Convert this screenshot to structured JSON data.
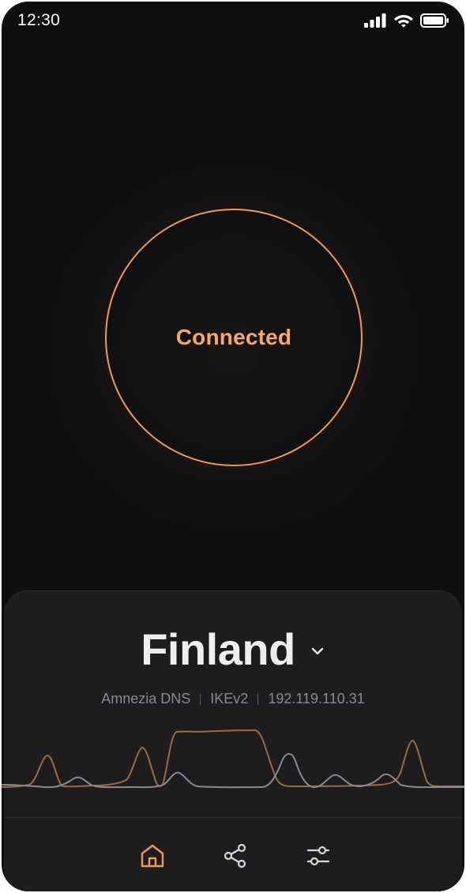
{
  "status_bar": {
    "time": "12:30",
    "signal_icon": "cellular-signal-icon",
    "wifi_icon": "wifi-icon",
    "battery_icon": "battery-icon"
  },
  "connection": {
    "status_label": "Connected",
    "accent_color": "#f09a56"
  },
  "location": {
    "country": "Finland",
    "dropdown_icon": "chevron-down-icon",
    "details": {
      "dns": "Amnezia DNS",
      "protocol": "IKEv2",
      "ip": "192.119.110.31"
    }
  },
  "traffic_graph": {
    "download_color": "#a06a3a",
    "upload_color": "#8a8a90"
  },
  "tabs": [
    {
      "icon": "home-icon",
      "active": true
    },
    {
      "icon": "share-icon",
      "active": false
    },
    {
      "icon": "settings-sliders-icon",
      "active": false
    }
  ],
  "colors": {
    "background": "#0f0f11",
    "panel": "#1d1d20",
    "text_primary": "#eeeeee",
    "text_secondary": "#8a8a8f",
    "tab_active": "#f09a56",
    "tab_inactive": "#d8d8dc"
  }
}
